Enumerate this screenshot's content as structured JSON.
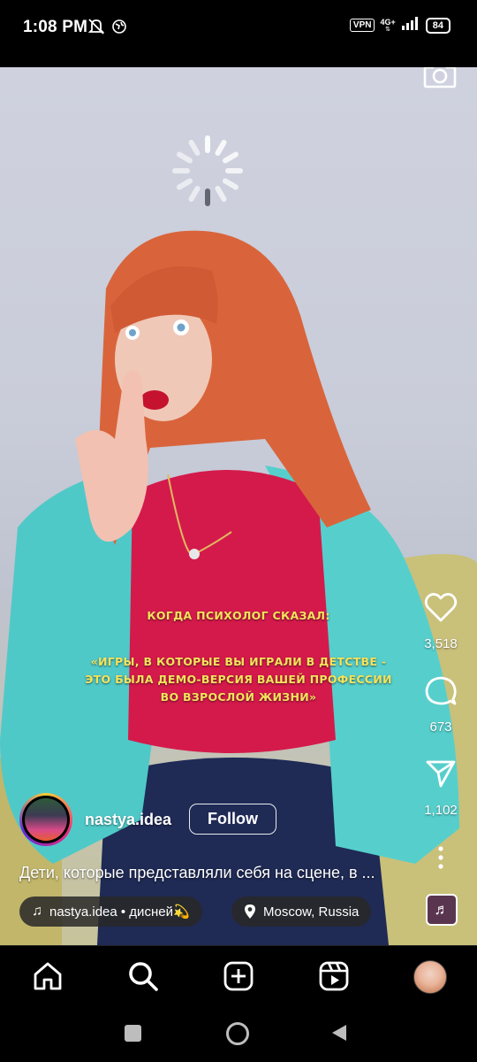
{
  "status_bar": {
    "time": "1:08 PM",
    "vpn_label": "VPN",
    "network_label": "4G+",
    "battery_level": "84"
  },
  "reel": {
    "overlay_title": "КОГДА ПСИХОЛОГ СКАЗАЛ:",
    "overlay_lines": [
      "«ИГРЫ, В КОТОРЫЕ ВЫ ИГРАЛИ В ДЕТСТВЕ -",
      "ЭТО БЫЛА ДЕМО-ВЕРСИЯ ВАШЕЙ ПРОФЕССИИ",
      "ВО ВЗРОСЛОЙ ЖИЗНИ»"
    ],
    "author": "nastya.idea",
    "follow_label": "Follow",
    "caption": "Дети, которые представляли себя на сцене, в ...",
    "audio_label": "nastya.idea • дисней💫",
    "location_label": "Moscow, Russia"
  },
  "actions": {
    "likes": "3,518",
    "comments": "673",
    "shares": "1,102"
  },
  "icons": {
    "camera": "camera-icon",
    "like": "heart-icon",
    "comment": "comment-bubble-icon",
    "share": "paper-plane-icon",
    "more": "more-vertical-icon",
    "audio_thumb": "music-note-icon",
    "nav": [
      "home-icon",
      "search-icon",
      "add-post-icon",
      "reels-icon",
      "profile-avatar"
    ],
    "system": [
      "recents-square-icon",
      "home-circle-icon",
      "back-triangle-icon"
    ]
  },
  "colors": {
    "overlay_text": "#f4e35c",
    "background": "#000000"
  }
}
